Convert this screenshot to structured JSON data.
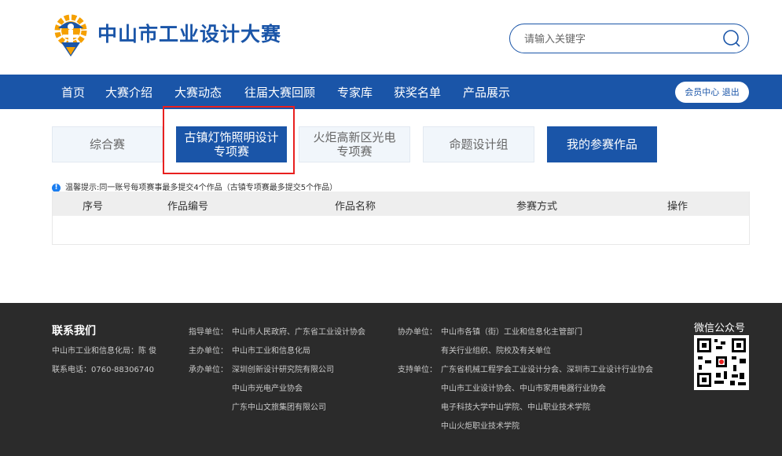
{
  "header": {
    "logo_title": "中山市工业设计大赛",
    "search_placeholder": "请输入关键字"
  },
  "nav": {
    "items": [
      "首页",
      "大赛介绍",
      "大赛动态",
      "往届大赛回顾",
      "专家库",
      "获奖名单",
      "产品展示"
    ],
    "member_center": "会员中心",
    "logout": "退出"
  },
  "tabs": [
    {
      "line1": "综合赛",
      "line2": ""
    },
    {
      "line1": "古镇灯饰照明设计",
      "line2": "专项赛"
    },
    {
      "line1": "火炬高新区光电",
      "line2": "专项赛"
    },
    {
      "line1": "命题设计组",
      "line2": ""
    },
    {
      "line1": "我的参赛作品",
      "line2": ""
    }
  ],
  "tip": {
    "icon": "info-icon",
    "text": "温馨提示:同一账号每项赛事最多提交4个作品（古镇专项赛最多提交5个作品）"
  },
  "table": {
    "headers": [
      "序号",
      "作品编号",
      "作品名称",
      "参赛方式",
      "操作"
    ],
    "rows": []
  },
  "footer": {
    "contact_title": "联系我们",
    "contact_lines": [
      "中山市工业和信息化局：陈 俊",
      "联系电话：0760-88306740"
    ],
    "guide_label": "指导单位：",
    "guide_value": "中山市人民政府、广东省工业设计协会",
    "host_label": "主办单位：",
    "host_value": "中山市工业和信息化局",
    "organizer_label": "承办单位：",
    "organizer_values": [
      "深圳创新设计研究院有限公司",
      "中山市光电产业协会",
      "广东中山文旅集团有限公司"
    ],
    "coorg_label": "协办单位：",
    "coorg_values": [
      "中山市各镇（街）工业和信息化主管部门",
      "有关行业组织、院校及有关单位"
    ],
    "support_label": "支持单位：",
    "support_values": [
      "广东省机械工程学会工业设计分会、深圳市工业设计行业协会",
      "中山市工业设计协会、中山市家用电器行业协会",
      "电子科技大学中山学院、中山职业技术学院",
      "中山火炬职业技术学院"
    ],
    "wechat_title": "微信公众号"
  },
  "colors": {
    "brand_blue": "#1a55a8",
    "highlight_red": "#e8201f",
    "footer_bg": "#2b2b2b"
  }
}
